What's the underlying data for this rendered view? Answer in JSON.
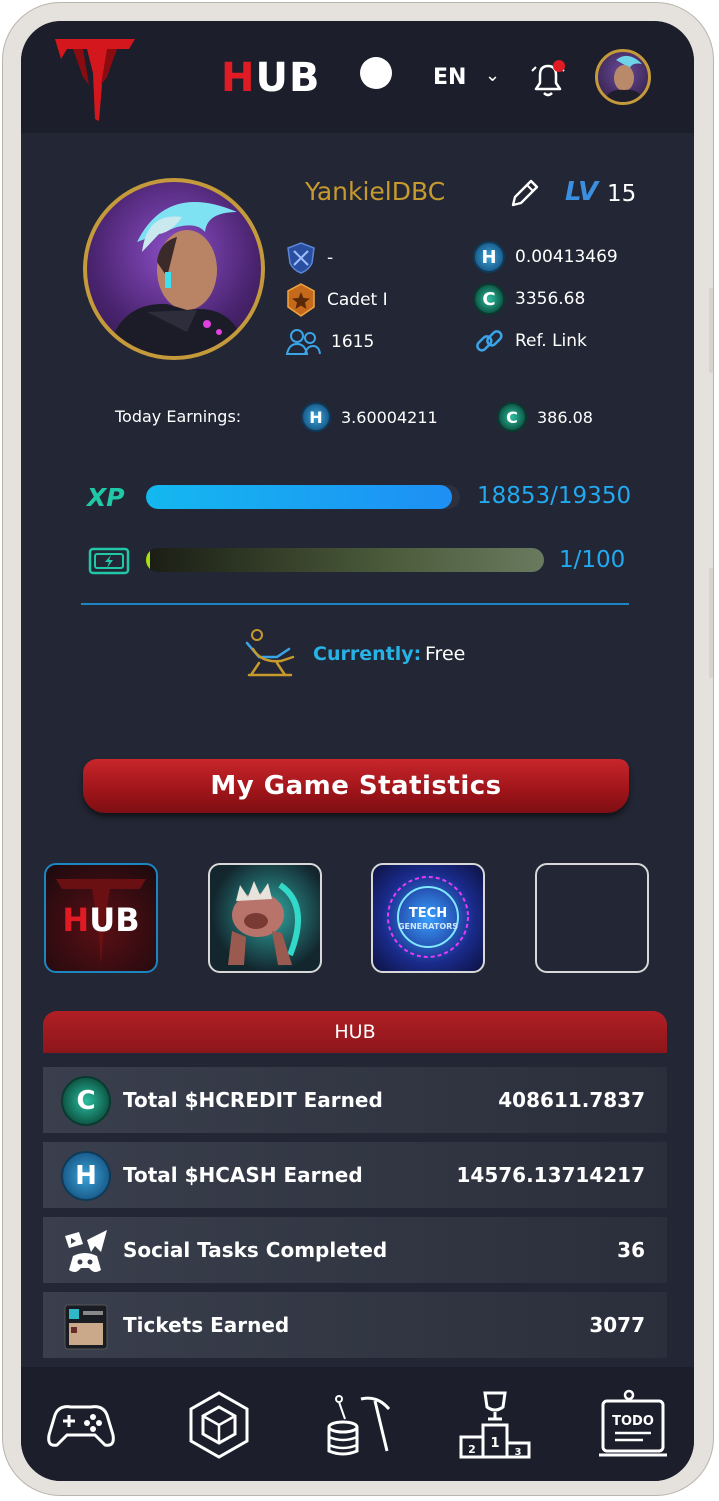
{
  "header": {
    "title_prefix": "H",
    "title_rest": "UB",
    "language": "EN"
  },
  "profile": {
    "username": "YankielDBC",
    "level_label": "LV",
    "level": "15",
    "rank_value": "-",
    "rank_title": "Cadet I",
    "followers": "1615",
    "hcash_balance": "0.00413469",
    "hcredit_balance": "3356.68",
    "ref_link_label": "Ref. Link"
  },
  "today": {
    "label": "Today Earnings:",
    "hcash": "3.60004211",
    "hcredit": "386.08"
  },
  "xp": {
    "label": "XP",
    "text": "18853/19350",
    "fraction": 0.974
  },
  "energy": {
    "text": "1/100",
    "fraction": 0.01
  },
  "status": {
    "label": "Currently:",
    "value": "Free"
  },
  "stats_banner": "My Game Statistics",
  "game_tiles": [
    {
      "name": "HUB",
      "label": "HUB",
      "selected": true
    },
    {
      "name": "Beast game",
      "label": "",
      "selected": false
    },
    {
      "name": "Tech Generators",
      "label": "TECH GENERATORS",
      "selected": false
    },
    {
      "name": "Empty",
      "label": "",
      "selected": false
    }
  ],
  "section_title": "HUB",
  "stats_rows": [
    {
      "icon": "hcredit-coin-icon",
      "label": "Total $HCREDIT Earned",
      "value": "408611.7837"
    },
    {
      "icon": "hcash-coin-icon",
      "label": "Total $HCASH Earned",
      "value": "14576.13714217"
    },
    {
      "icon": "social-icon",
      "label": "Social Tasks Completed",
      "value": "36"
    },
    {
      "icon": "ticket-icon",
      "label": "Tickets Earned",
      "value": "3077"
    }
  ],
  "nav": [
    "gamepad-icon",
    "cube-icon",
    "mining-icon",
    "podium-icon",
    "todo-icon"
  ],
  "colors": {
    "background": "#232634",
    "bar_bg": "#1c1f2b",
    "accent_red": "#b01f24",
    "accent_gold": "#c79a2e",
    "accent_blue": "#22a9f0",
    "accent_teal": "#21c8a8"
  }
}
